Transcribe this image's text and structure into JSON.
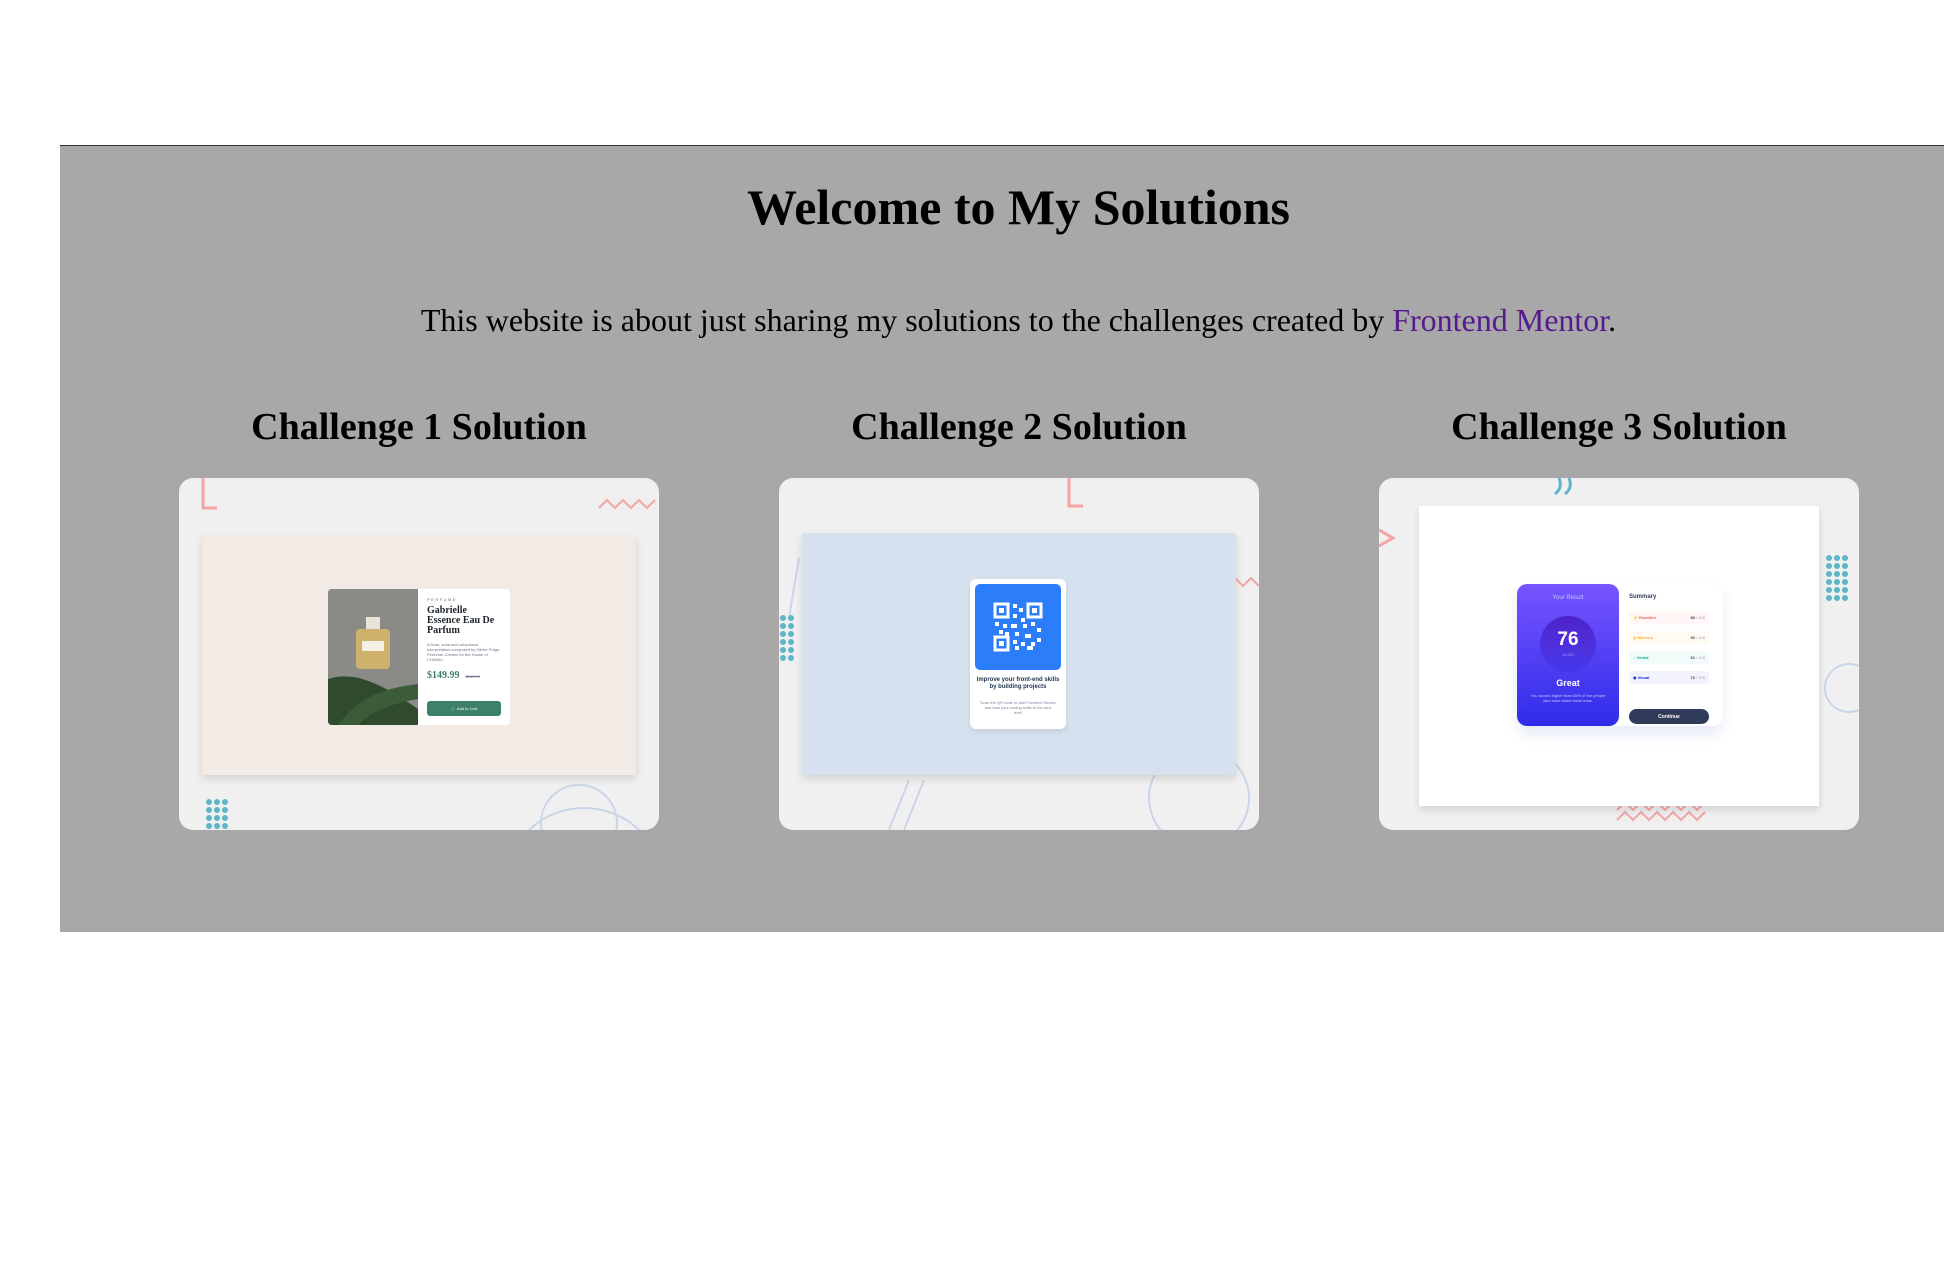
{
  "header": {
    "title": "Welcome to My Solutions",
    "intro_text": "This website is about just sharing my solutions to the challenges created by ",
    "intro_link": "Frontend Mentor",
    "intro_end": "."
  },
  "challenges": [
    {
      "title": "Challenge 1 Solution",
      "preview": {
        "category": "PERFUME",
        "product_name": "Gabrielle Essence Eau De Parfum",
        "description": "A floral, solar and voluptuous interpretation composed by Olivier Polge, Perfumer-Creator for the House of CHANEL.",
        "price": "$149.99",
        "old_price": "$169.99",
        "button": "Add to Cart"
      }
    },
    {
      "title": "Challenge 2 Solution",
      "preview": {
        "heading": "Improve your front-end skills by building projects",
        "description": "Scan the QR code to visit Frontend Mentor and take your coding skills to the next level"
      }
    },
    {
      "title": "Challenge 3 Solution",
      "preview": {
        "result_label": "Your Result",
        "score": "76",
        "score_of": "of 100",
        "rating": "Great",
        "rating_desc": "You scored higher than 65% of the people who have taken these tests.",
        "summary_label": "Summary",
        "categories": [
          {
            "name": "Reaction",
            "score": "80",
            "max": " / 100",
            "color": "#ff5757",
            "bg": "#fff6f5"
          },
          {
            "name": "Memory",
            "score": "92",
            "max": " / 100",
            "color": "#ffb01f",
            "bg": "#fffbf2"
          },
          {
            "name": "Verbal",
            "score": "61",
            "max": " / 100",
            "color": "#00bb8f",
            "bg": "#f2fbfa"
          },
          {
            "name": "Visual",
            "score": "72",
            "max": " / 100",
            "color": "#1125d6",
            "bg": "#f3f3fd"
          }
        ],
        "continue_button": "Continue"
      }
    }
  ],
  "colors": {
    "section_bg": "#a8a8a8",
    "card_bg": "#f0f0f0",
    "link": "#551a8b"
  }
}
